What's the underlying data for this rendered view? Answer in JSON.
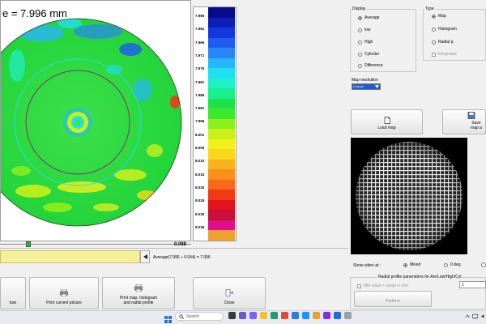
{
  "map": {
    "title": "e = 7.996 mm"
  },
  "colorbar": {
    "colors": [
      "#0a0a8c",
      "#0c1fb8",
      "#1437e0",
      "#1e5cf0",
      "#2a86f7",
      "#27b6fa",
      "#1fe0f0",
      "#1ff0c8",
      "#18f08c",
      "#1de04a",
      "#3ee82a",
      "#8cf01c",
      "#c8f01a",
      "#f0f01a",
      "#f8d81a",
      "#f8b41a",
      "#f8901a",
      "#f86a18",
      "#f03a14",
      "#e0141a",
      "#c8103a",
      "#e0108c",
      "#f0a030"
    ],
    "labels": [
      "7.956",
      "7.961",
      "7.966",
      "7.971",
      "7.976",
      "7.981",
      "7.986",
      "7.991",
      "7.996",
      "8.001",
      "8.006",
      "8.010",
      "8.015",
      "8.020",
      "8.025",
      "8.030",
      "8.035"
    ]
  },
  "slider": {
    "value": "0.088"
  },
  "avg_text": "Average(7.996 ÷ 0.044) = 7.996",
  "display_group": {
    "title": "Display",
    "options": [
      {
        "label": "Average",
        "selected": true
      },
      {
        "label": "low",
        "selected": false
      },
      {
        "label": "High",
        "selected": false
      },
      {
        "label": "Cylinder",
        "selected": false
      },
      {
        "label": "Difference",
        "selected": false
      }
    ]
  },
  "type_group": {
    "title": "Type",
    "options": [
      {
        "label": "Map",
        "selected": true
      },
      {
        "label": "Histogram",
        "selected": false
      },
      {
        "label": "Radial p.",
        "selected": false
      }
    ],
    "integrated_label": "Integrated"
  },
  "map_resolution": {
    "label": "Map resolution",
    "value": "Coarse"
  },
  "buttons": {
    "load_map": "Load map",
    "save_map": "Save map a",
    "print_left": "ture",
    "print_current": "Print current picture",
    "print_map_hist": "Print map, histogram\nand radial profile",
    "close": "Close",
    "radial_compute": "Perform"
  },
  "show_video": {
    "label": "Show video at :",
    "options": [
      {
        "label": "Mixed",
        "selected": true
      },
      {
        "label": "0 deg",
        "selected": false
      }
    ]
  },
  "radial": {
    "title": "Radial profile parameters for Avr/Low/High/Cyl",
    "checkbox_label": "Mid value = range in mm",
    "input_value": "1"
  },
  "taskbar": {
    "search_placeholder": "Search",
    "icons": [
      {
        "name": "task-view-icon",
        "color": "#3a3a3a"
      },
      {
        "name": "meet-icon",
        "color": "#6a5acd"
      },
      {
        "name": "chat-icon",
        "color": "#7b61ff"
      },
      {
        "name": "explorer-icon",
        "color": "#f2c230"
      },
      {
        "name": "edge-icon",
        "color": "#1a9f6a"
      },
      {
        "name": "chrome-icon",
        "color": "#e04a3a"
      },
      {
        "name": "store-icon",
        "color": "#2e7de0"
      },
      {
        "name": "mail-icon",
        "color": "#1e90ff"
      },
      {
        "name": "app-icon",
        "color": "#f0a020"
      },
      {
        "name": "winrar-icon",
        "color": "#8a2be2"
      },
      {
        "name": "pdf-icon",
        "color": "#1c6fd6"
      },
      {
        "name": "recycle-icon",
        "color": "#9aa0a8"
      }
    ]
  }
}
